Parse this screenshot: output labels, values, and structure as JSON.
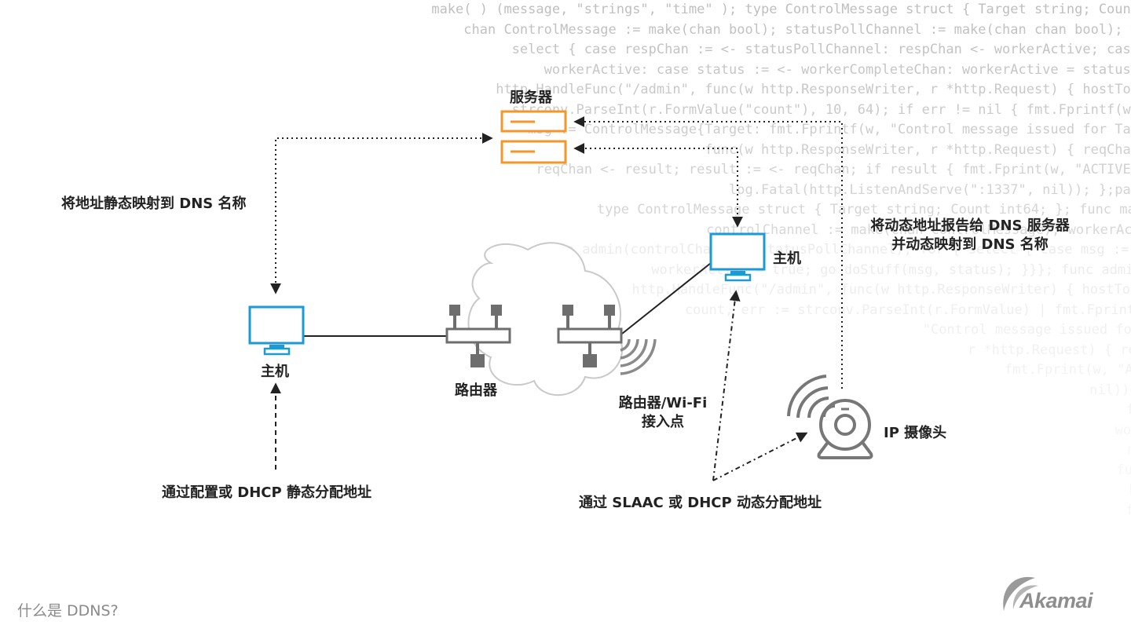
{
  "diagram": {
    "title": "什么是 DDNS?",
    "brand": "Akamai",
    "nodes": {
      "server": "服务器",
      "host_left": "主机",
      "host_right": "主机",
      "router": "路由器",
      "router_wifi_line1": "路由器/Wi-Fi",
      "router_wifi_line2": "接入点",
      "ip_camera": "IP 摄像头"
    },
    "annotations": {
      "static_dns": "将地址静态映射到 DNS 名称",
      "dynamic_dns_line1": "将动态地址报告给 DNS 服务器",
      "dynamic_dns_line2": "并动态映射到 DNS 名称",
      "static_assign": "通过配置或 DHCP 静态分配地址",
      "dynamic_assign": "通过 SLAAC 或 DHCP 动态分配地址"
    },
    "colors": {
      "server": "#f5962a",
      "host": "#1a9ad6",
      "router": "#6e6e6e",
      "camera": "#777777",
      "text": "#222222",
      "muted": "#8a8a8a"
    },
    "background_code": [
      "make( ) (message, \"strings\", \"time\" ); type ControlMessage struct { Target string; Count",
      "chan ControlMessage := make(chan bool); statusPollChannel := make(chan chan bool); w",
      "select { case respChan := <- statusPollChannel: respChan <- workerActive; case",
      "workerActive: case status := <- workerCompleteChan: workerActive = status;",
      "http.HandleFunc(\"/admin\", func(w http.ResponseWriter, r *http.Request) { hostTok",
      "strconv.ParseInt(r.FormValue(\"count\"), 10, 64); if err != nil { fmt.Fprintf(w,",
      "msg := ControlMessage{Target: fmt.Fprintf(w, \"Control message issued for Tar",
      "func(w http.ResponseWriter, r *http.Request) { reqChan",
      "reqChan <- result; result := <- reqChan; if result { fmt.Fprint(w, \"ACTIVE\"",
      "log.Fatal(http.ListenAndServe(\":1337\", nil)); };pac",
      "type ControlMessage struct { Target string; Count int64; }; func mai",
      "controlChannel := make(chan ControlMessage); workerActi",
      "go admin(controlChannel, statusPollChannel); for { select { case msg := <-",
      "workerActive = true; go doStuff(msg, status); }}}; func admin(c",
      "http.HandleFunc(\"/admin\", func(w http.ResponseWriter) { hostTokens",
      "count, err := strconv.ParseInt(r.FormValue) | fmt.Fprintf(w,",
      "\"Control message issued for Tar",
      "r *http.Request) { reqChan",
      "fmt.Fprint(w, \"ACTIVE\"",
      "nil)); };pac",
      "func mai",
      "workerActi",
      "msg := <-",
      "func admin(",
      "hostTokens",
      "fmt.Fprintf"
    ]
  }
}
